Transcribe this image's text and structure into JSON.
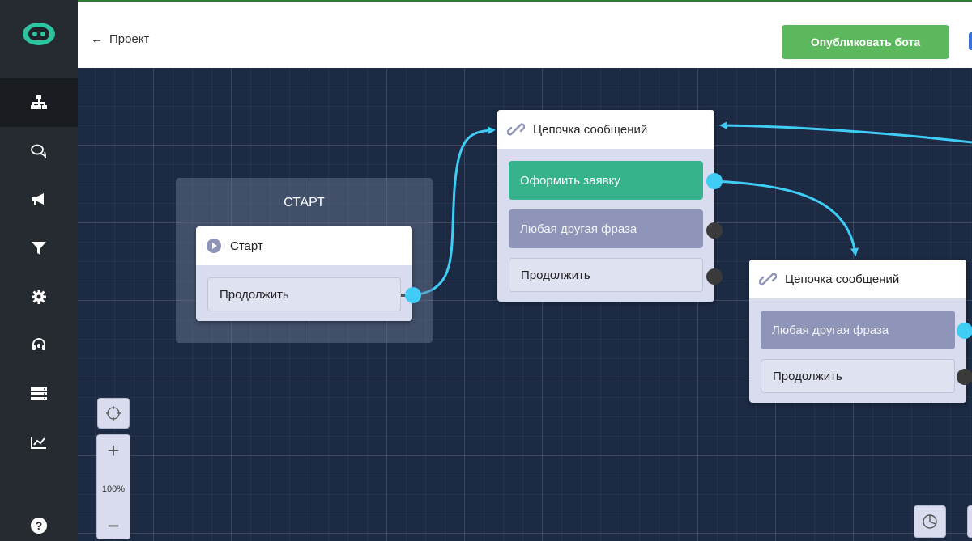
{
  "header": {
    "back_label": "Проект",
    "publish_label": "Опубликовать бота"
  },
  "canvas": {
    "start_group_title": "СТАРТ",
    "start_node": {
      "title": "Старт",
      "buttons": [
        "Продолжить"
      ]
    },
    "chain_node_1": {
      "title": "Цепочка сообщений",
      "buttons": [
        "Оформить заявку",
        "Любая другая фраза",
        "Продолжить"
      ]
    },
    "chain_node_2": {
      "title": "Цепочка сообщений",
      "buttons": [
        "Любая другая фраза",
        "Продолжить"
      ]
    }
  },
  "zoom": {
    "level": "100%"
  },
  "colors": {
    "sidebar": "#262b31",
    "canvas": "#1c2a44",
    "publish": "#5cb85c",
    "green_button": "#36b38c",
    "gray_button": "#8f95b8",
    "connector": "#3fcdf6"
  },
  "sidebar_icons": [
    "logo-icon",
    "flow-icon",
    "chat-icon",
    "megaphone-icon",
    "filter-icon",
    "settings-icon",
    "support-icon",
    "database-icon",
    "analytics-icon",
    "help-icon"
  ]
}
